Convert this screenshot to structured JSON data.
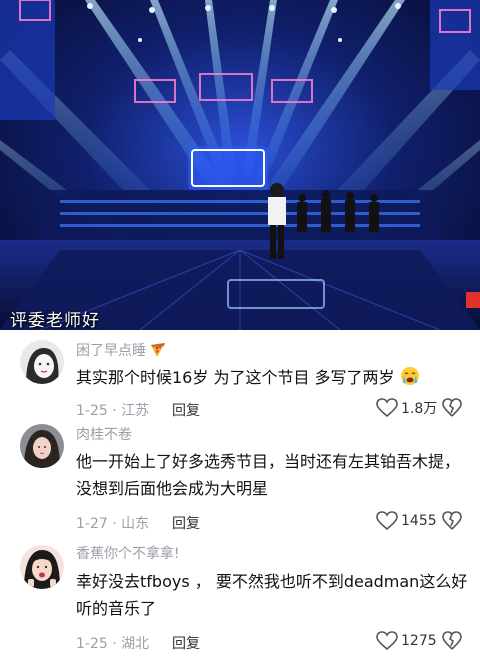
{
  "video": {
    "subtitle": "评委老师好",
    "colors": {
      "stage_blue": "#1d3fd0",
      "beam": "#7fd4ff",
      "floor": "#0a1240"
    }
  },
  "comments": [
    {
      "username": "困了早点睡",
      "username_emoji": "pizza-icon",
      "text": "其实那个时候16岁 为了这个节目 多写了两岁",
      "text_emoji": "crying-face-icon",
      "date": "1-25",
      "location": "江苏",
      "reply_label": "回复",
      "likes": "1.8万"
    },
    {
      "username": "肉桂不卷",
      "text": "他一开始上了好多选秀节目，当时还有左其铂吾木提，没想到后面他会成为大明星",
      "date": "1-27",
      "location": "山东",
      "reply_label": "回复",
      "likes": "1455"
    },
    {
      "username": "香蕉你个不拿拿!",
      "text": "幸好没去tfboys ， 要不然我也听不到deadman这么好听的音乐了",
      "date": "1-25",
      "location": "湖北",
      "reply_label": "回复",
      "likes": "1275"
    }
  ]
}
